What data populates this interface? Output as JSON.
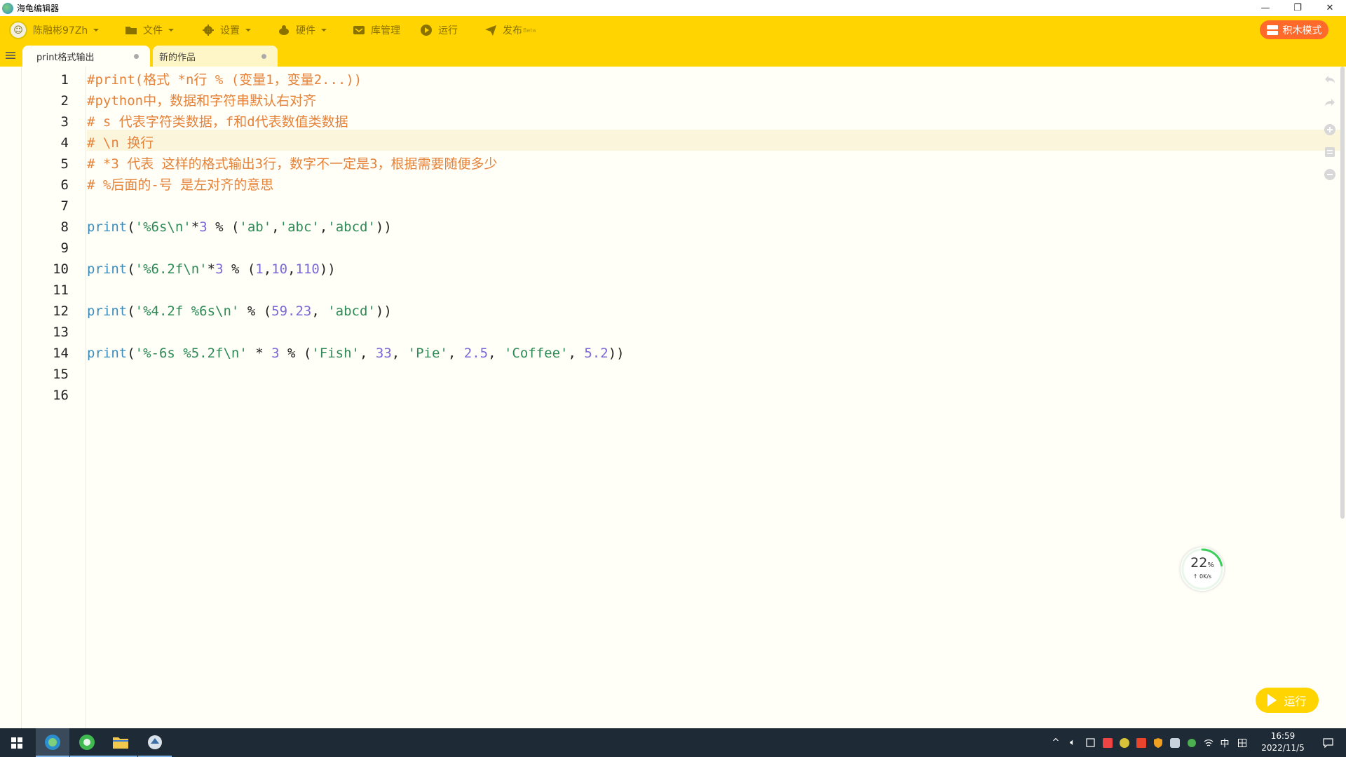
{
  "window": {
    "title": "海龟编辑器",
    "controls": [
      "—",
      "❐",
      "✕"
    ]
  },
  "toolbar": {
    "user_name": "陈融彬97Zh",
    "items": [
      {
        "label": "文件",
        "icon": "folder-icon",
        "dropdown": true
      },
      {
        "label": "设置",
        "icon": "gear-icon",
        "dropdown": true
      },
      {
        "label": "硬件",
        "icon": "hardware-icon",
        "dropdown": true
      },
      {
        "label": "库管理",
        "icon": "library-icon",
        "dropdown": false
      },
      {
        "label": "运行",
        "icon": "play-circle-icon",
        "dropdown": false
      },
      {
        "label": "发布",
        "icon": "send-icon",
        "dropdown": false,
        "badge": "Beta"
      }
    ],
    "blocks_mode_label": "积木模式",
    "accent_color": "#ffd400",
    "blocks_color": "#ff6a2b"
  },
  "tabs": [
    {
      "label": "print格式输出",
      "active": true
    },
    {
      "label": "新的作品",
      "active": false
    }
  ],
  "editor": {
    "line_numbers": [
      "1",
      "2",
      "3",
      "4",
      "5",
      "6",
      "7",
      "8",
      "9",
      "10",
      "11",
      "12",
      "13",
      "14",
      "15",
      "16"
    ],
    "highlighted_line": 4,
    "lines": [
      [
        {
          "t": "#print(格式 *n行 % (变量1，变量2...))",
          "c": "comment"
        }
      ],
      [
        {
          "t": "#python中，数据和字符串默认右对齐",
          "c": "comment"
        }
      ],
      [
        {
          "t": "# s 代表字符类数据，f和d代表数值类数据",
          "c": "comment"
        }
      ],
      [
        {
          "t": "# \\n 换行",
          "c": "comment"
        }
      ],
      [
        {
          "t": "# *3 代表 这样的格式输出3行，数字不一定是3，根据需要随便多少",
          "c": "comment"
        }
      ],
      [
        {
          "t": "# %后面的-号 是左对齐的意思",
          "c": "comment"
        }
      ],
      [],
      [
        {
          "t": "print",
          "c": "fn"
        },
        {
          "t": "(",
          "c": "op"
        },
        {
          "t": "'%6s\\n'",
          "c": "str"
        },
        {
          "t": "*",
          "c": "op"
        },
        {
          "t": "3",
          "c": "num"
        },
        {
          "t": " % (",
          "c": "op"
        },
        {
          "t": "'ab'",
          "c": "str"
        },
        {
          "t": ",",
          "c": "op"
        },
        {
          "t": "'abc'",
          "c": "str"
        },
        {
          "t": ",",
          "c": "op"
        },
        {
          "t": "'abcd'",
          "c": "str"
        },
        {
          "t": "))",
          "c": "op"
        }
      ],
      [],
      [
        {
          "t": "print",
          "c": "fn"
        },
        {
          "t": "(",
          "c": "op"
        },
        {
          "t": "'%6.2f\\n'",
          "c": "str"
        },
        {
          "t": "*",
          "c": "op"
        },
        {
          "t": "3",
          "c": "num"
        },
        {
          "t": " % (",
          "c": "op"
        },
        {
          "t": "1",
          "c": "num"
        },
        {
          "t": ",",
          "c": "op"
        },
        {
          "t": "10",
          "c": "num"
        },
        {
          "t": ",",
          "c": "op"
        },
        {
          "t": "110",
          "c": "num"
        },
        {
          "t": "))",
          "c": "op"
        }
      ],
      [],
      [
        {
          "t": "print",
          "c": "fn"
        },
        {
          "t": "(",
          "c": "op"
        },
        {
          "t": "'%4.2f %6s\\n'",
          "c": "str"
        },
        {
          "t": " % (",
          "c": "op"
        },
        {
          "t": "59.23",
          "c": "num"
        },
        {
          "t": ", ",
          "c": "op"
        },
        {
          "t": "'abcd'",
          "c": "str"
        },
        {
          "t": "))",
          "c": "op"
        }
      ],
      [],
      [
        {
          "t": "print",
          "c": "fn"
        },
        {
          "t": "(",
          "c": "op"
        },
        {
          "t": "'%-6s %5.2f\\n'",
          "c": "str"
        },
        {
          "t": " * ",
          "c": "op"
        },
        {
          "t": "3",
          "c": "num"
        },
        {
          "t": " % (",
          "c": "op"
        },
        {
          "t": "'Fish'",
          "c": "str"
        },
        {
          "t": ", ",
          "c": "op"
        },
        {
          "t": "33",
          "c": "num"
        },
        {
          "t": ", ",
          "c": "op"
        },
        {
          "t": "'Pie'",
          "c": "str"
        },
        {
          "t": ", ",
          "c": "op"
        },
        {
          "t": "2.5",
          "c": "num"
        },
        {
          "t": ", ",
          "c": "op"
        },
        {
          "t": "'Coffee'",
          "c": "str"
        },
        {
          "t": ", ",
          "c": "op"
        },
        {
          "t": "5.2",
          "c": "num"
        },
        {
          "t": "))",
          "c": "op"
        }
      ],
      [],
      []
    ]
  },
  "side_tools": [
    "undo-icon",
    "redo-icon",
    "zoom-in-icon",
    "format-icon",
    "zoom-out-icon"
  ],
  "speed_widget": {
    "percent": "22",
    "percent_unit": "%",
    "rate": "0K/s",
    "fraction": 0.22
  },
  "run_button": {
    "label": "运行"
  },
  "taskbar": {
    "apps": [
      "windows-start-icon",
      "turtle-editor-icon",
      "browser-icon",
      "file-explorer-icon",
      "python-idle-icon"
    ],
    "tray_ime": "中",
    "clock_time": "16:59",
    "clock_date": "2022/11/5"
  }
}
